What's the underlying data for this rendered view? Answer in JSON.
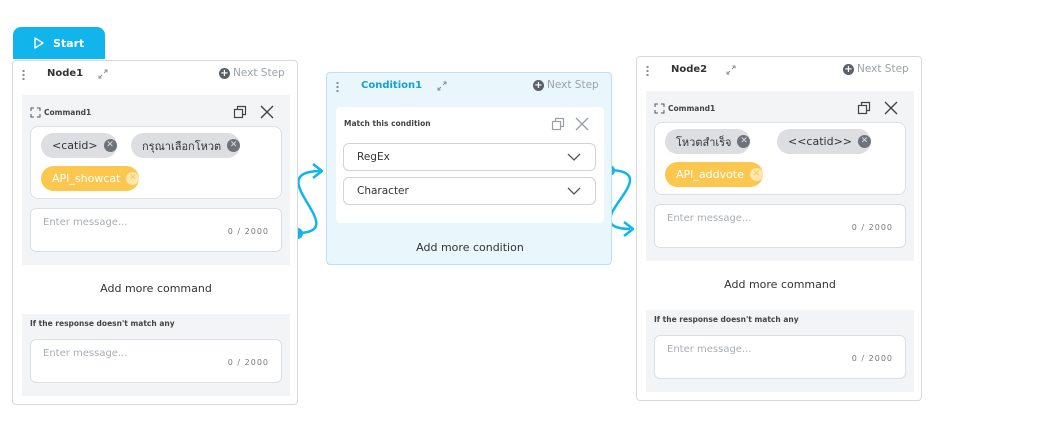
{
  "start": {
    "label": "Start",
    "icon": "play-icon"
  },
  "node1": {
    "title": "Node1",
    "next_step": "Next Step",
    "command_title": "Command1",
    "chips": [
      {
        "label": "<catid>",
        "color": "gray"
      },
      {
        "label": "กรุณาเลือกโหวต",
        "color": "gray"
      },
      {
        "label": "API_showcat",
        "color": "yellow"
      }
    ],
    "message_placeholder": "Enter message...",
    "message_count": "0 / 2000",
    "add_more_command": "Add more command",
    "fallback_title": "If the response doesn't match any",
    "fallback_placeholder": "Enter message...",
    "fallback_count": "0 / 2000"
  },
  "condition1": {
    "title": "Condition1",
    "next_step": "Next Step",
    "match_title": "Match this condition",
    "select_1": "RegEx",
    "select_2": "Character",
    "add_more_condition": "Add more condition"
  },
  "node2": {
    "title": "Node2",
    "next_step": "Next Step",
    "command_title": "Command1",
    "chips": [
      {
        "label": "โหวตสำเร็จ",
        "color": "gray"
      },
      {
        "label": "<<catid>>",
        "color": "gray"
      },
      {
        "label": "API_addvote",
        "color": "yellow"
      }
    ],
    "message_placeholder": "Enter message...",
    "message_count": "0 / 2000",
    "add_more_command": "Add more command",
    "fallback_title": "If the response doesn't match any",
    "fallback_placeholder": "Enter message...",
    "fallback_count": "0 / 2000"
  },
  "colors": {
    "accent": "#11b5ec",
    "chip_gray": "#dcdee2",
    "chip_yellow": "#fbc74f"
  }
}
